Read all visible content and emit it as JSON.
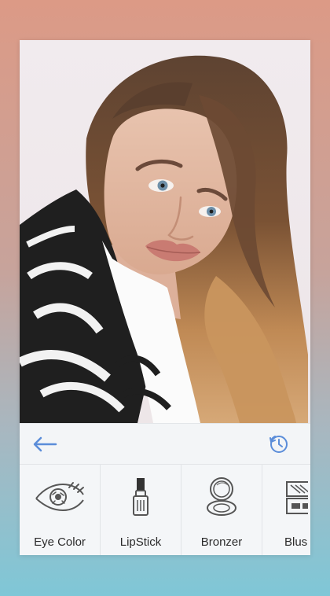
{
  "app": {
    "background_top": "#DC9A86",
    "background_bottom": "#7FC7D7",
    "accent": "#5B8DD9"
  },
  "toolbar": {
    "back_icon": "back-arrow-icon",
    "history_icon": "history-icon"
  },
  "tools": [
    {
      "label": "Eye Color",
      "icon": "eye-icon"
    },
    {
      "label": "LipStick",
      "icon": "lipstick-icon"
    },
    {
      "label": "Bronzer",
      "icon": "compact-icon"
    },
    {
      "label": "Blus",
      "icon": "palette-icon"
    }
  ]
}
